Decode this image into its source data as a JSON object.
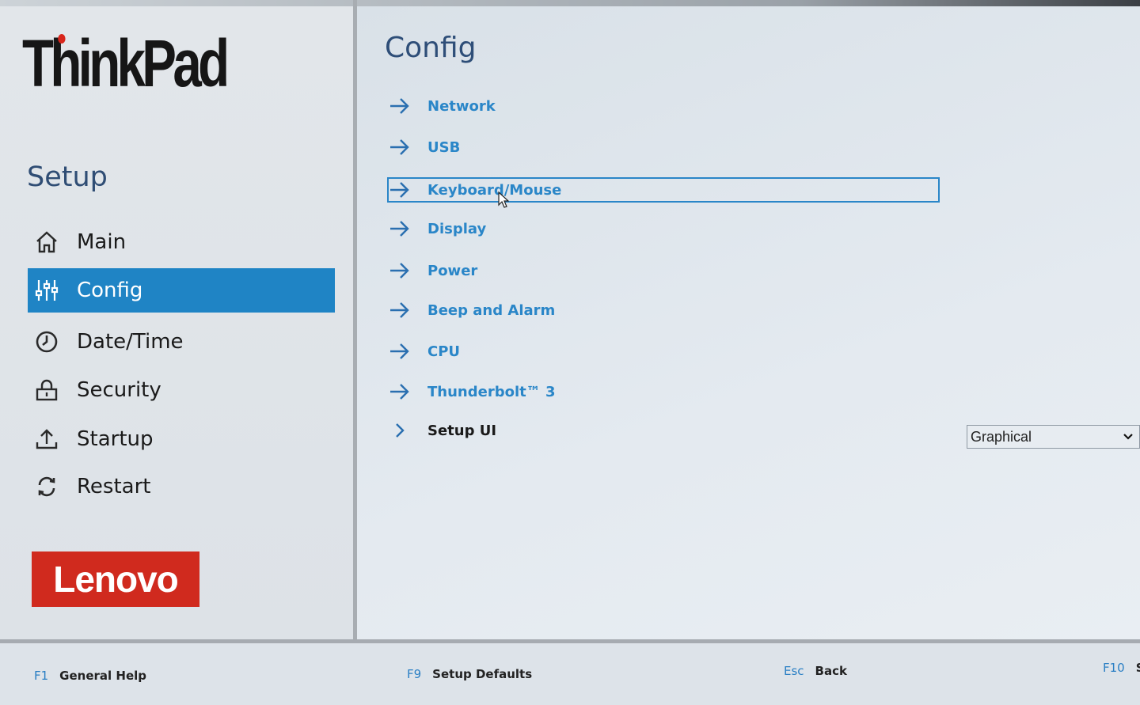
{
  "brand": {
    "product": "ThinkPad",
    "vendor": "Lenovo"
  },
  "sidebar": {
    "title": "Setup",
    "items": [
      {
        "label": "Main",
        "icon": "home-icon"
      },
      {
        "label": "Config",
        "icon": "sliders-icon",
        "active": true
      },
      {
        "label": "Date/Time",
        "icon": "clock-icon"
      },
      {
        "label": "Security",
        "icon": "lock-icon"
      },
      {
        "label": "Startup",
        "icon": "upload-icon"
      },
      {
        "label": "Restart",
        "icon": "restart-icon"
      }
    ]
  },
  "main": {
    "title": "Config",
    "items": [
      {
        "label": "Network",
        "icon": "arrow-right-icon"
      },
      {
        "label": "USB",
        "icon": "arrow-right-icon"
      },
      {
        "label": "Keyboard/Mouse",
        "icon": "arrow-right-icon",
        "selected": true
      },
      {
        "label": "Display",
        "icon": "arrow-right-icon"
      },
      {
        "label": "Power",
        "icon": "arrow-right-icon"
      },
      {
        "label": "Beep and Alarm",
        "icon": "arrow-right-icon"
      },
      {
        "label": "CPU",
        "icon": "arrow-right-icon"
      },
      {
        "label": "Thunderbolt™ 3",
        "icon": "arrow-right-icon"
      },
      {
        "label": "Setup UI",
        "icon": "chevron-right-icon"
      }
    ],
    "setup_ui_value": "Graphical"
  },
  "footer": {
    "keys": [
      {
        "key": "F1",
        "label": "General Help"
      },
      {
        "key": "F9",
        "label": "Setup Defaults"
      },
      {
        "key": "Esc",
        "label": "Back"
      },
      {
        "key": "F10",
        "label": "S"
      }
    ]
  },
  "colors": {
    "accent": "#1f84c5",
    "link": "#2a86c8",
    "lenovo_red": "#d02a1e",
    "heading": "#2e4e78"
  }
}
